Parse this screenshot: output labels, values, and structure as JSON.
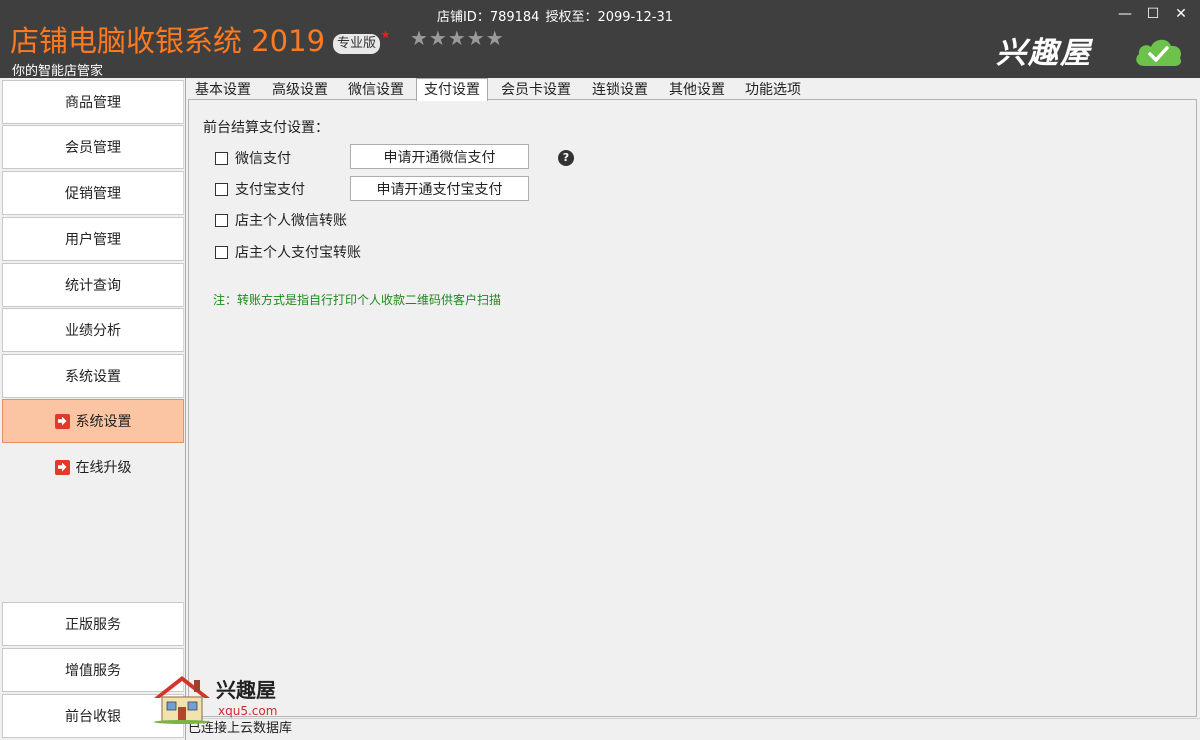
{
  "header": {
    "app_title": "店铺电脑收银系统 2019",
    "edition": "专业版",
    "stars": "★★★★★",
    "slogan": "你的智能店管家",
    "store_id_label": "店铺ID：789184",
    "license_label": "授权至：2099-12-31",
    "brand": "兴趣屋",
    "minimize": "—",
    "maximize": "☐",
    "close": "✕"
  },
  "sidebar": {
    "items": [
      {
        "label": "商品管理"
      },
      {
        "label": "会员管理"
      },
      {
        "label": "促销管理"
      },
      {
        "label": "用户管理"
      },
      {
        "label": "统计查询"
      },
      {
        "label": "业绩分析"
      },
      {
        "label": "系统设置"
      }
    ],
    "sub_items": [
      {
        "label": "系统设置",
        "active": true
      },
      {
        "label": "在线升级",
        "active": false
      }
    ],
    "bottom_items": [
      {
        "label": "正版服务"
      },
      {
        "label": "增值服务"
      },
      {
        "label": "前台收银"
      }
    ]
  },
  "tabs": [
    {
      "label": "基本设置"
    },
    {
      "label": "高级设置"
    },
    {
      "label": "微信设置"
    },
    {
      "label": "支付设置",
      "active": true
    },
    {
      "label": "会员卡设置"
    },
    {
      "label": "连锁设置"
    },
    {
      "label": "其他设置"
    },
    {
      "label": "功能选项"
    }
  ],
  "payment": {
    "section_title": "前台结算支付设置：",
    "options": [
      {
        "label": "微信支付",
        "checked": false,
        "button": "申请开通微信支付"
      },
      {
        "label": "支付宝支付",
        "checked": false,
        "button": "申请开通支付宝支付"
      },
      {
        "label": "店主个人微信转账",
        "checked": false
      },
      {
        "label": "店主个人支付宝转账",
        "checked": false
      }
    ],
    "help": "?",
    "note": "注：转账方式是指自行打印个人收款二维码供客户扫描"
  },
  "status": {
    "text": "已连接上云数据库"
  },
  "watermark": {
    "name": "兴趣屋",
    "url": "xqu5.com"
  },
  "colors": {
    "titlebar": "#3f3f3f",
    "title_orange": "#ff7a1f",
    "active_sidebar": "#fbc4a3",
    "note_green": "#1a8a1a",
    "cloud_green": "#6cc24a"
  }
}
